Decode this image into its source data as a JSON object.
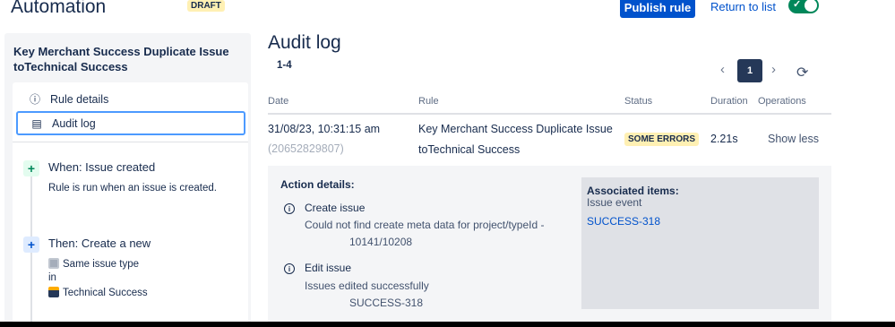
{
  "header": {
    "title": "Automation",
    "draft_badge": "DRAFT",
    "publish_label": "Publish rule",
    "return_label": "Return to list",
    "toggle_on": true
  },
  "sidebar": {
    "rule_name": "Key Merchant Success Duplicate Issue toTechnical Success",
    "nav": [
      {
        "label": "Rule details",
        "icon": "info-icon"
      },
      {
        "label": "Audit log",
        "icon": "document-icon",
        "active": true
      }
    ],
    "flow": {
      "trigger_title": "When: Issue created",
      "trigger_desc": "Rule is run when an issue is created.",
      "action_title": "Then: Create a new",
      "action_type": "Same issue type",
      "action_in": "in",
      "action_project": "Technical Success"
    }
  },
  "audit": {
    "title": "Audit log",
    "range": "1-4",
    "page": "1",
    "columns": {
      "date": "Date",
      "rule": "Rule",
      "status": "Status",
      "duration": "Duration",
      "operations": "Operations"
    },
    "row": {
      "date": "31/08/23, 10:31:15 am",
      "id": "(20652829807)",
      "rule_line1": "Key Merchant Success Duplicate Issue",
      "rule_line2": "toTechnical Success",
      "status": "SOME ERRORS",
      "duration": "2.21s",
      "operation": "Show less"
    },
    "details": {
      "heading": "Action details:",
      "action1_title": "Create issue",
      "action1_line1": "Could not find create meta data for project/typeId -",
      "action1_line2": "10141/10208",
      "action2_title": "Edit issue",
      "action2_line1": "Issues edited successfully",
      "action2_line2": "SUCCESS-318",
      "assoc_heading": "Associated items:",
      "assoc_type": "Issue event",
      "assoc_link": "SUCCESS-318"
    }
  },
  "colors": {
    "primary": "#0052cc",
    "toggle_on": "#00875a",
    "badge_yellow": "#fff0b3",
    "panel_bg": "#f4f5f7"
  }
}
